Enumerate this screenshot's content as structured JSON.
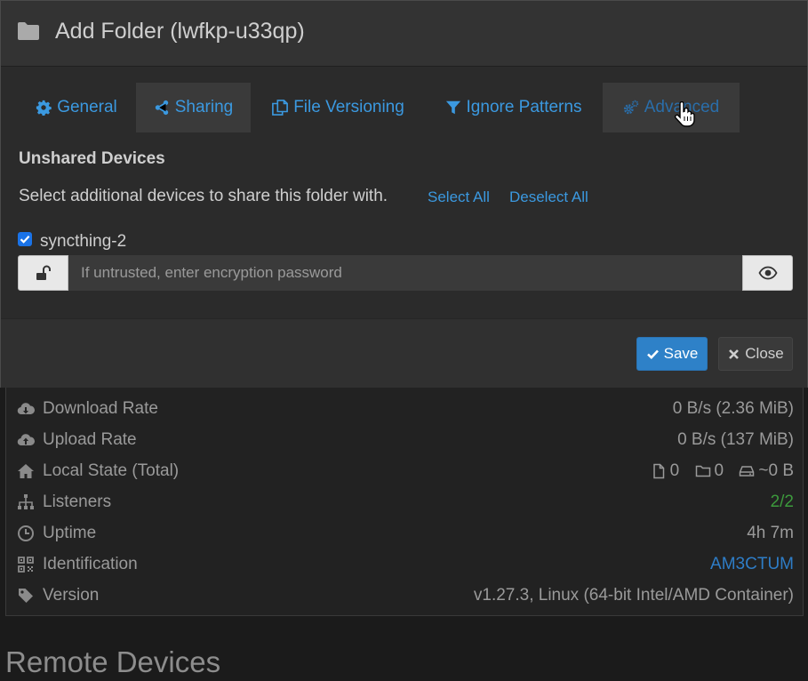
{
  "modal": {
    "title": "Add Folder (lwfkp-u33qp)",
    "tabs": [
      {
        "label": "General",
        "icon": "gear-icon"
      },
      {
        "label": "Sharing",
        "icon": "share-icon"
      },
      {
        "label": "File Versioning",
        "icon": "copy-icon"
      },
      {
        "label": "Ignore Patterns",
        "icon": "filter-icon"
      },
      {
        "label": "Advanced",
        "icon": "gears-icon"
      }
    ],
    "active_tab": "Sharing",
    "section_title": "Unshared Devices",
    "select_text": "Select additional devices to share this folder with.",
    "select_all": "Select All",
    "deselect_all": "Deselect All",
    "device": {
      "name": "syncthing-2",
      "checked": true
    },
    "password_placeholder": "If untrusted, enter encryption password",
    "save_label": "Save",
    "close_label": "Close"
  },
  "stats": [
    {
      "label": "Download Rate",
      "value": "0 B/s (2.36 MiB)",
      "icon": "cloud-download-icon"
    },
    {
      "label": "Upload Rate",
      "value": "0 B/s (137 MiB)",
      "icon": "cloud-upload-icon"
    },
    {
      "label": "Local State (Total)",
      "icon": "home-icon",
      "files": "0",
      "folders": "0",
      "size": "~0 B"
    },
    {
      "label": "Listeners",
      "value": "2/2",
      "icon": "sitemap-icon",
      "color": "#3c9a3c"
    },
    {
      "label": "Uptime",
      "value": "4h 7m",
      "icon": "clock-icon"
    },
    {
      "label": "Identification",
      "value": "AM3CTUM",
      "icon": "qrcode-icon",
      "color": "#2e7dc7"
    },
    {
      "label": "Version",
      "value": "v1.27.3, Linux (64-bit Intel/AMD Container)",
      "icon": "tag-icon"
    }
  ],
  "remote_devices_title": "Remote Devices",
  "colors": {
    "accent": "#3b99e0",
    "primary_button": "#2e81c8",
    "background": "#1b1b1b"
  }
}
